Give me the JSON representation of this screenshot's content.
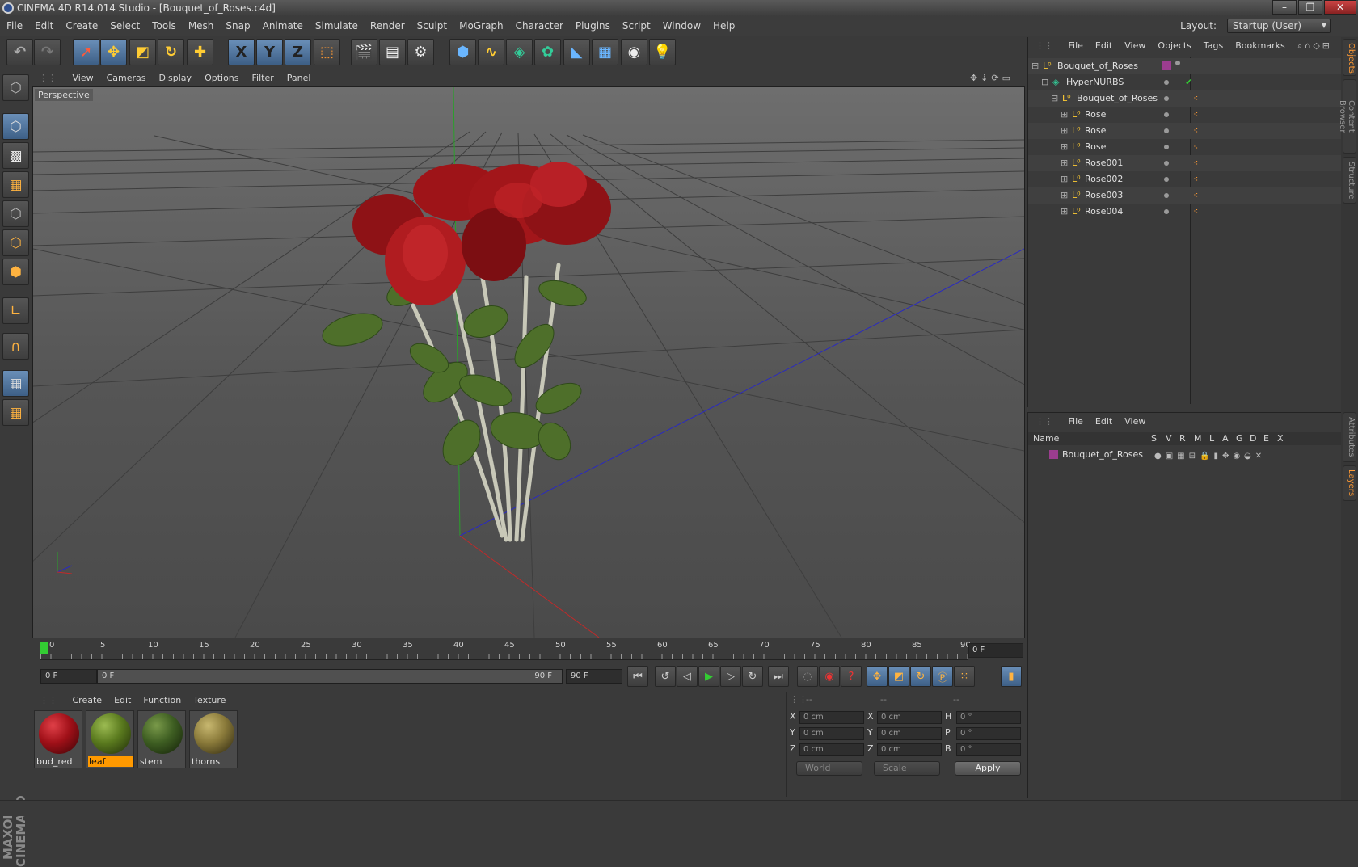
{
  "window": {
    "title": "CINEMA 4D R14.014 Studio - [Bouquet_of_Roses.c4d]",
    "controls": [
      "–",
      "❐",
      "✕"
    ]
  },
  "menubar": {
    "items": [
      "File",
      "Edit",
      "Create",
      "Select",
      "Tools",
      "Mesh",
      "Snap",
      "Animate",
      "Simulate",
      "Render",
      "Sculpt",
      "MoGraph",
      "Character",
      "Plugins",
      "Script",
      "Window",
      "Help"
    ],
    "layout_label": "Layout:",
    "layout_value": "Startup (User)"
  },
  "toolbar": {
    "icons": [
      "undo-icon",
      "redo-icon",
      "select-icon",
      "move-icon",
      "scale-icon",
      "rotate-icon",
      "last-tool-icon",
      "x-axis-icon",
      "y-axis-icon",
      "z-axis-icon",
      "world-coords-icon",
      "render-view-icon",
      "render-picture-viewer-icon",
      "render-settings-icon",
      "cube-icon",
      "spline-icon",
      "nurbs-icon",
      "array-icon",
      "deformer-icon",
      "floor-icon",
      "camera-icon",
      "light-icon"
    ],
    "axis_labels": [
      "X",
      "Y",
      "Z"
    ]
  },
  "viewport": {
    "menu": [
      "View",
      "Cameras",
      "Display",
      "Options",
      "Filter",
      "Panel"
    ],
    "label": "Perspective"
  },
  "timeline": {
    "ticks": [
      "0",
      "5",
      "10",
      "15",
      "20",
      "25",
      "30",
      "35",
      "40",
      "45",
      "50",
      "55",
      "60",
      "65",
      "70",
      "75",
      "80",
      "85",
      "90"
    ],
    "current_frame": "0 F"
  },
  "transport": {
    "start_field": "0 F",
    "range_start": "0 F",
    "range_end": "90 F",
    "end_field": "90 F"
  },
  "materials": {
    "menu": [
      "Create",
      "Edit",
      "Function",
      "Texture"
    ],
    "items": [
      {
        "name": "bud_red",
        "color": "#a01018",
        "selected": false
      },
      {
        "name": "leaf",
        "color": "#5a7a1e",
        "selected": true
      },
      {
        "name": "stem",
        "color": "#3e5e22",
        "selected": false
      },
      {
        "name": "thorns",
        "color": "#8a7a3a",
        "selected": false
      }
    ]
  },
  "coordinates": {
    "headers": [
      "--",
      "--",
      "--"
    ],
    "rows": [
      {
        "a": "X",
        "av": "0 cm",
        "b": "X",
        "bv": "0 cm",
        "c": "H",
        "cv": "0 °"
      },
      {
        "a": "Y",
        "av": "0 cm",
        "b": "Y",
        "bv": "0 cm",
        "c": "P",
        "cv": "0 °"
      },
      {
        "a": "Z",
        "av": "0 cm",
        "b": "Z",
        "bv": "0 cm",
        "c": "B",
        "cv": "0 °"
      }
    ],
    "mode1": "World",
    "mode2": "Scale",
    "apply": "Apply"
  },
  "objects": {
    "menu": [
      "File",
      "Edit",
      "View",
      "Objects",
      "Tags",
      "Bookmarks"
    ],
    "tree": [
      {
        "name": "Bouquet_of_Roses",
        "depth": 0
      },
      {
        "name": "HyperNURBS",
        "depth": 1
      },
      {
        "name": "Bouquet_of_Roses",
        "depth": 2
      },
      {
        "name": "Rose",
        "depth": 3
      },
      {
        "name": "Rose",
        "depth": 3
      },
      {
        "name": "Rose",
        "depth": 3
      },
      {
        "name": "Rose001",
        "depth": 3
      },
      {
        "name": "Rose002",
        "depth": 3
      },
      {
        "name": "Rose003",
        "depth": 3
      },
      {
        "name": "Rose004",
        "depth": 3
      }
    ]
  },
  "layers": {
    "menu": [
      "File",
      "Edit",
      "View"
    ],
    "columns": [
      "Name",
      "S",
      "V",
      "R",
      "M",
      "L",
      "A",
      "G",
      "D",
      "E",
      "X"
    ],
    "rows": [
      {
        "name": "Bouquet_of_Roses",
        "color": "#9b3d8f"
      }
    ]
  },
  "side_tabs": [
    "Objects",
    "Content Browser",
    "Structure",
    "Attributes",
    "Layers"
  ],
  "colors": {
    "accent": "#ff9933",
    "selection": "#6a8fb8",
    "background": "#3a3a3a"
  }
}
